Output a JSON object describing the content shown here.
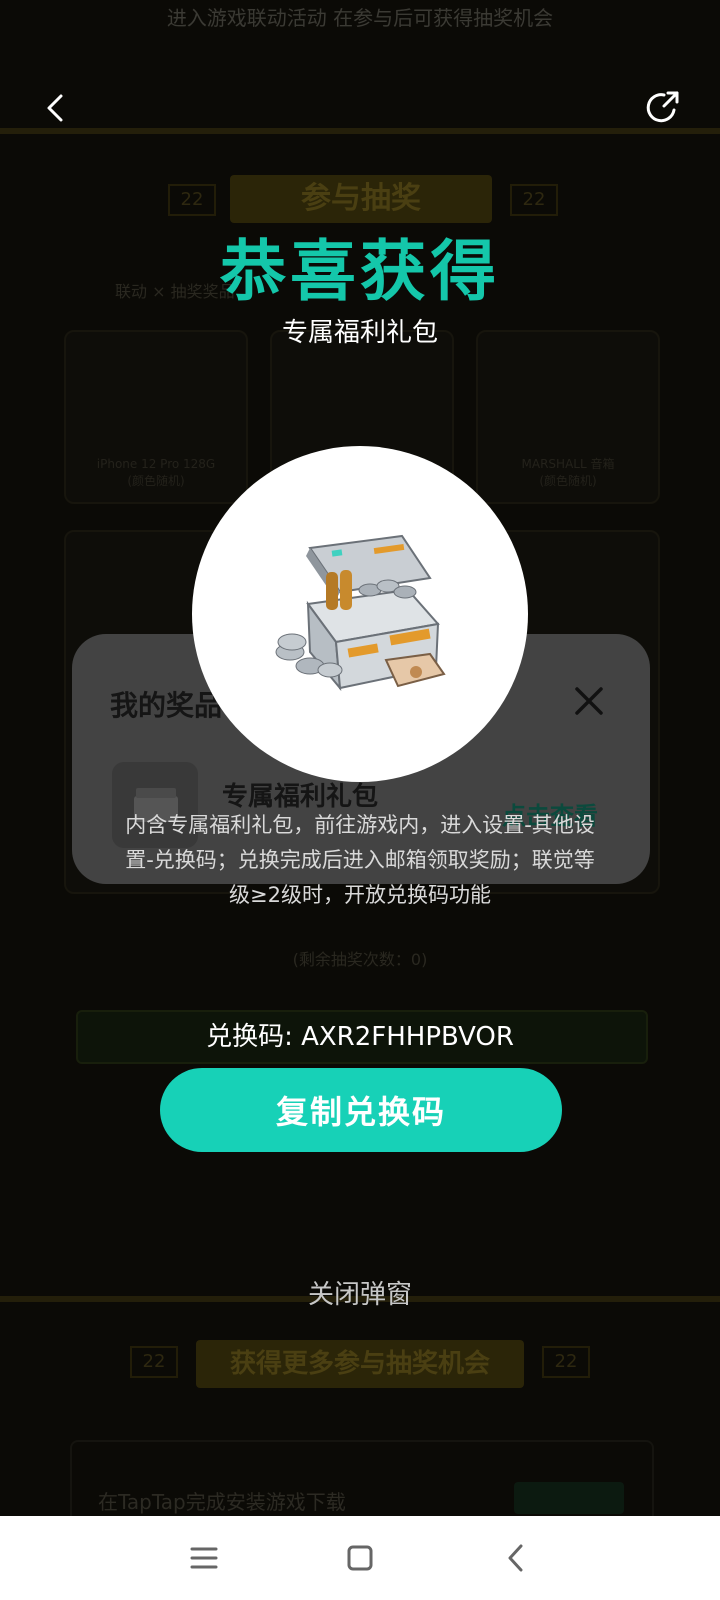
{
  "background": {
    "top_text": "进入游戏联动活动 在参与后可获得抽奖机会",
    "title": "参与抽奖",
    "title_deco_left": "22",
    "title_deco_right": "22",
    "subtitle": "联动 × 抽奖奖品",
    "cards": [
      {
        "label": "iPhone 12 Pro 128G\n(颜色随机)"
      },
      {
        "label": ""
      },
      {
        "label": "MARSHALL 音箱\n(颜色随机)"
      }
    ],
    "counter": "(剩余抽奖次数：0)",
    "lower_title": "获得更多参与抽奖机会",
    "lower_deco_left": "22",
    "lower_deco_right": "22",
    "bottom_text": "在TapTap完成安装游戏下载"
  },
  "prize_panel": {
    "title": "我的奖品",
    "item_name": "专属福利礼包",
    "link": "点击查看"
  },
  "modal": {
    "title": "恭喜获得",
    "subtitle": "专属福利礼包",
    "description": "内含专属福利礼包，前往游戏内，进入设置-其他设置-兑换码；兑换完成后进入邮箱领取奖励；联觉等级≥2级时，开放兑换码功能",
    "code_line": "兑换码: AXR2FHHPBVOR",
    "copy_button": "复制兑换码",
    "close_label": "关闭弹窗"
  },
  "icons": {
    "back": "back-arrow-icon",
    "share": "share-icon",
    "close": "close-icon",
    "menu": "menu-icon",
    "home": "home-icon",
    "sys_back": "system-back-icon"
  },
  "colors": {
    "accent": "#14c7aa",
    "button": "#17d1b7",
    "panel": "#434343"
  }
}
